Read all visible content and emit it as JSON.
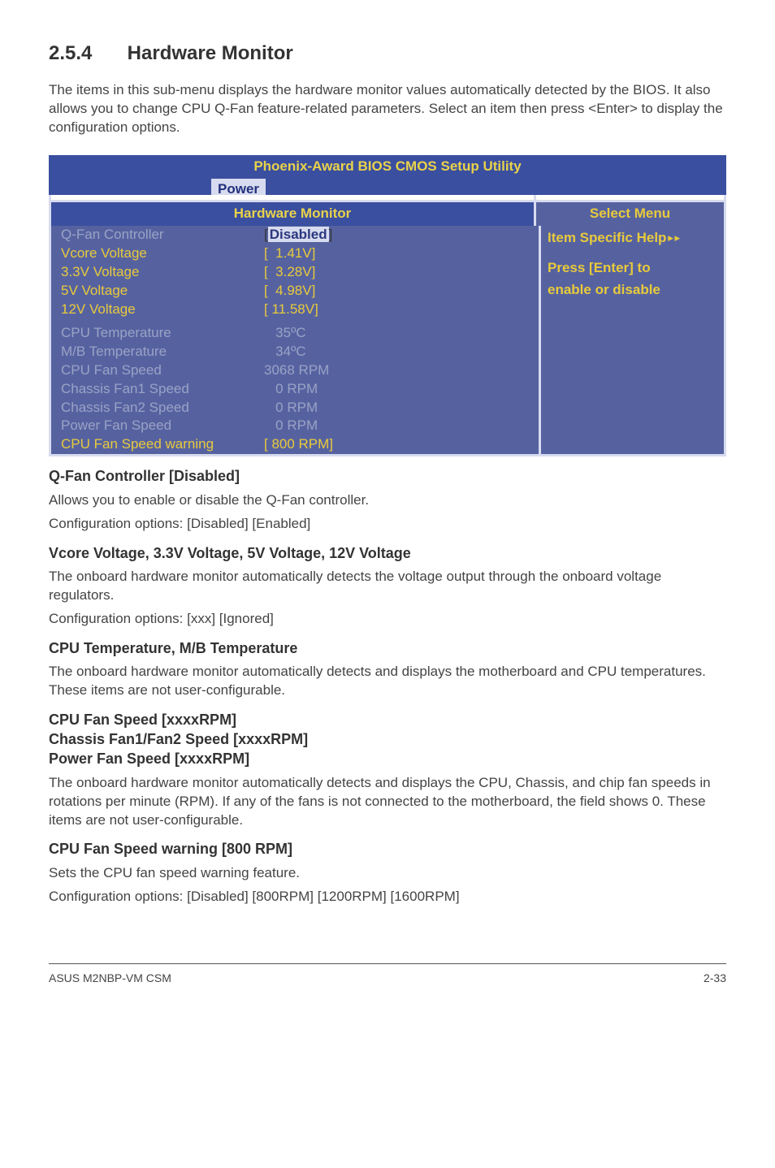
{
  "heading": {
    "number": "2.5.4",
    "title": "Hardware Monitor"
  },
  "intro": "The items in this sub-menu displays the hardware monitor values automatically detected by the BIOS. It also allows you to change CPU Q-Fan feature-related parameters. Select an item then press <Enter> to display the configuration options.",
  "bios": {
    "title": "Phoenix-Award BIOS CMOS Setup Utility",
    "tab": "Power",
    "panel_title": "Hardware Monitor",
    "select_menu": "Select Menu",
    "help": {
      "line1a": "Item Specific Help",
      "line1b": "▸▸",
      "line2": "Press [Enter] to",
      "line3": "enable or disable"
    },
    "rows_top": [
      {
        "label": "Q-Fan Controller",
        "value": "Disabled",
        "selected": true,
        "label_grey": true
      },
      {
        "label": "Vcore Voltage",
        "value": "[  1.41V]"
      },
      {
        "label": "3.3V Voltage",
        "value": "[  3.28V]"
      },
      {
        "label": "5V Voltage",
        "value": "[  4.98V]"
      },
      {
        "label": "12V Voltage",
        "value": "[ 11.58V]"
      }
    ],
    "rows_bottom": [
      {
        "label": "CPU Temperature",
        "value": "   35ºC"
      },
      {
        "label": "M/B Temperature",
        "value": "   34ºC"
      },
      {
        "label": "CPU Fan Speed",
        "value": "3068 RPM"
      },
      {
        "label": "Chassis Fan1 Speed",
        "value": "   0 RPM"
      },
      {
        "label": "Chassis Fan2 Speed",
        "value": "   0 RPM"
      },
      {
        "label": "Power Fan Speed",
        "value": "   0 RPM"
      },
      {
        "label": "CPU Fan Speed warning",
        "value": "[ 800 RPM]",
        "yellow": true
      }
    ]
  },
  "sections": [
    {
      "title": "Q-Fan Controller [Disabled]",
      "paras": [
        "Allows you to enable or disable the Q-Fan controller.",
        "Configuration options: [Disabled] [Enabled]"
      ]
    },
    {
      "title": "Vcore Voltage, 3.3V Voltage, 5V Voltage, 12V Voltage",
      "paras": [
        "The onboard hardware monitor automatically detects the voltage output through the onboard voltage regulators.",
        "Configuration options: [xxx] [Ignored]"
      ]
    },
    {
      "title": "CPU Temperature, M/B Temperature",
      "paras": [
        "The onboard hardware monitor automatically detects and displays the motherboard and CPU temperatures. These items are not user-configurable."
      ]
    },
    {
      "title": "CPU Fan Speed [xxxxRPM]\nChassis Fan1/Fan2 Speed [xxxxRPM]\nPower Fan Speed [xxxxRPM]",
      "paras": [
        "The onboard hardware monitor automatically detects and displays the CPU, Chassis, and chip fan speeds in rotations per minute (RPM). If any of the fans is not connected to the motherboard, the field shows 0. These items are not user-configurable."
      ]
    },
    {
      "title": "CPU Fan Speed warning [800 RPM]",
      "paras": [
        "Sets the CPU fan speed warning feature.",
        "Configuration options: [Disabled] [800RPM] [1200RPM] [1600RPM]"
      ]
    }
  ],
  "footer": {
    "left": "ASUS M2NBP-VM CSM",
    "right": "2-33"
  }
}
